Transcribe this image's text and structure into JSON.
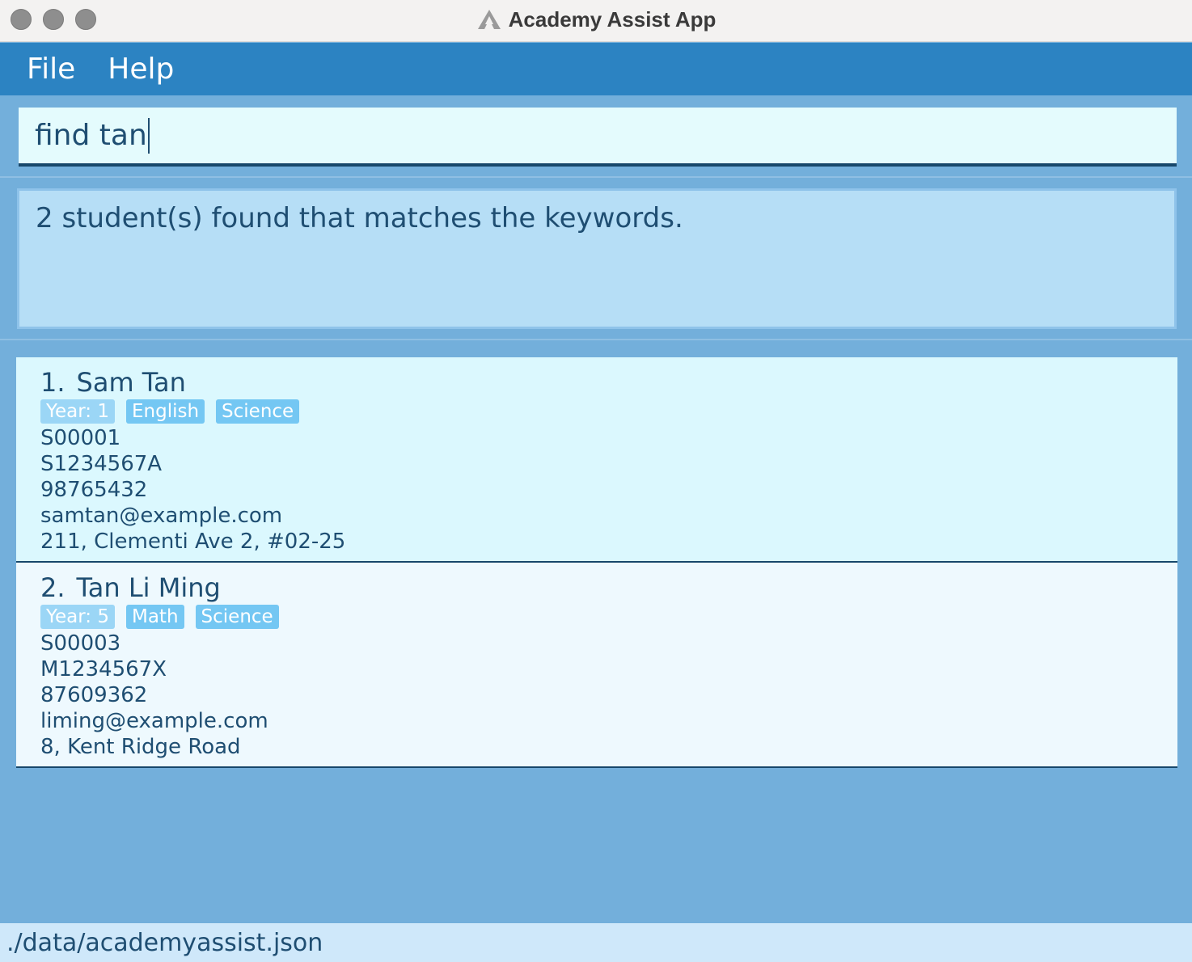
{
  "window": {
    "title": "Academy Assist App",
    "logo_icon": "academy-logo-icon"
  },
  "menu": {
    "items": [
      {
        "label": "File"
      },
      {
        "label": "Help"
      }
    ]
  },
  "command": {
    "value": "find tan"
  },
  "result": {
    "message": "2 student(s) found that matches the keywords."
  },
  "students": [
    {
      "index": "1.",
      "name": "Sam Tan",
      "year_tag": "Year: 1",
      "subjects": [
        "English",
        "Science"
      ],
      "student_id": "S00001",
      "nric": "S1234567A",
      "phone": "98765432",
      "email": "samtan@example.com",
      "address": "211, Clementi Ave 2, #02-25"
    },
    {
      "index": "2.",
      "name": "Tan Li Ming",
      "year_tag": "Year: 5",
      "subjects": [
        "Math",
        "Science"
      ],
      "student_id": "S00003",
      "nric": "M1234567X",
      "phone": "87609362",
      "email": "liming@example.com",
      "address": "8, Kent Ridge Road"
    }
  ],
  "status": {
    "file_path": "./data/academyassist.json"
  },
  "colors": {
    "menubar": "#2c83c2",
    "background": "#73afdb",
    "tag": "#74c7f3",
    "text": "#1f4e72"
  }
}
